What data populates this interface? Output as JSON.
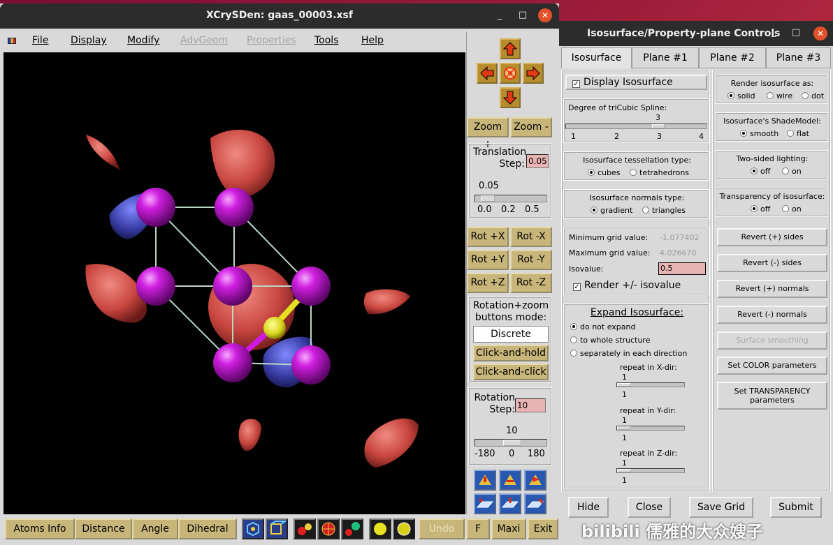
{
  "main_window": {
    "title": "XCrySDen: gaas_00003.xsf",
    "controls": [
      "_",
      "□",
      "✕"
    ],
    "menu": [
      "File",
      "Display",
      "Modify",
      "AdvGeom",
      "Properties",
      "Tools",
      "Help"
    ],
    "menu_disabled": [
      "AdvGeom",
      "Properties"
    ]
  },
  "side_panel": {
    "zoom_plus": "Zoom +",
    "zoom_minus": "Zoom -",
    "translation_label": "Translation\nStep:",
    "translation_value": "0.05",
    "translation_slider_value": "0.05",
    "translation_ticks": [
      "0.0",
      "0.2",
      "0.5"
    ],
    "translation_level": 0.1,
    "rot_buttons": [
      "Rot +X",
      "Rot -X",
      "Rot +Y",
      "Rot -Y",
      "Rot +Z",
      "Rot -Z"
    ],
    "mode_label": "Rotation+zoom\nbuttons mode:",
    "mode_discrete": "Discrete",
    "mode_click_hold": "Click-and-hold",
    "mode_click_click": "Click-and-click",
    "rotation_label": "Rotation\nStep:",
    "rotation_value": "10",
    "rotation_slider_value": "10",
    "rotation_ticks": [
      "-180",
      "0",
      "180"
    ],
    "rotation_level": 0.53
  },
  "bottom_bar": {
    "atoms_info": "Atoms Info",
    "distance": "Distance",
    "angle": "Angle",
    "dihedral": "Dihedral",
    "undo": "Undo",
    "f": "F",
    "maxi": "Maxi",
    "exit": "Exit"
  },
  "iso_dialog": {
    "title": "Isosurface/Property-plane Controls",
    "controls": [
      "_",
      "□",
      "✕"
    ],
    "tabs": [
      "Isosurface",
      "Plane #1",
      "Plane #2",
      "Plane #3"
    ],
    "display_isosurface": "Display Isosurface",
    "spline_label": "Degree of triCubic Spline:",
    "spline_value": "3",
    "spline_ticks": [
      "1",
      "2",
      "3",
      "4"
    ],
    "tessellation_label": "Isosurface tessellation type:",
    "tessellation_options": [
      "cubes",
      "tetrahedrons"
    ],
    "normals_label": "Isosurface normals type:",
    "normals_options": [
      "gradient",
      "triangles"
    ],
    "min_grid_label": "Minimum grid value:",
    "min_grid_value": "-1.077402",
    "max_grid_label": "Maximum grid value:",
    "max_grid_value": "4.026670",
    "isovalue_label": "Isovalue:",
    "isovalue": "0.5",
    "render_pm": "Render +/- isovalue",
    "expand_label": "Expand Isosurface:",
    "expand_options": [
      "do not expand",
      "to whole structure",
      "separately in each direction"
    ],
    "repeat_x": "repeat in X-dir:",
    "repeat_y": "repeat in Y-dir:",
    "repeat_z": "repeat in Z-dir:",
    "repeat_value": "1",
    "render_as_label": "Render isosurface as:",
    "render_as_options": [
      "solid",
      "wire",
      "dot"
    ],
    "shade_label": "Isosurface's ShadeModel:",
    "shade_options": [
      "smooth",
      "flat"
    ],
    "two_sided_label": "Two-sided lighting:",
    "transparency_label": "Transparency of isosurface:",
    "onoff": [
      "off",
      "on"
    ],
    "buttons": [
      "Revert (+) sides",
      "Revert (-) sides",
      "Revert (+) normals",
      "Revert (-) normals",
      "Surface smoothing",
      "Set COLOR parameters",
      "Set TRANSPARENCY parameters"
    ],
    "footer": [
      "Hide",
      "Close",
      "Save Grid",
      "Submit"
    ]
  },
  "watermark": "bilibili 儒雅的大众嫂子"
}
